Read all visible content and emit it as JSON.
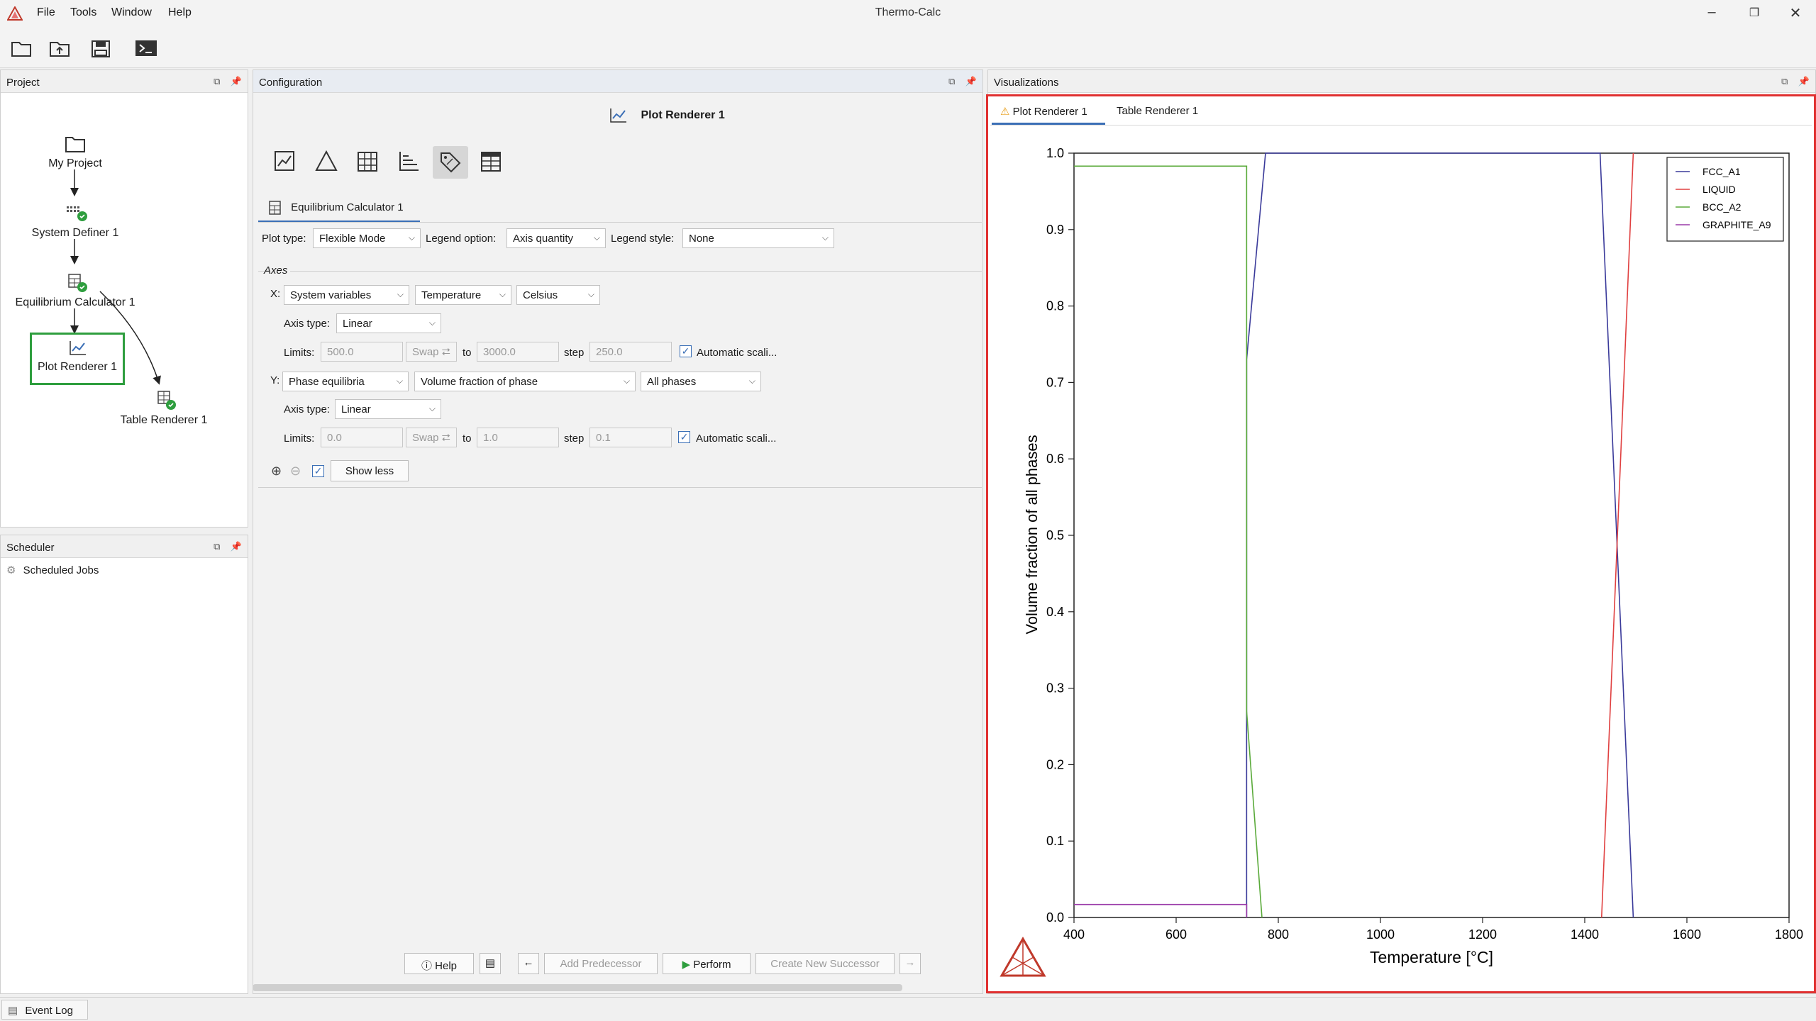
{
  "app": {
    "title": "Thermo-Calc",
    "menu": [
      "File",
      "Tools",
      "Window",
      "Help"
    ],
    "window_controls": {
      "minimize": "–",
      "restore": "❐",
      "close": "✕"
    }
  },
  "project_panel": {
    "title": "Project",
    "nodes": [
      {
        "label": "My Project"
      },
      {
        "label": "System Definer 1"
      },
      {
        "label": "Equilibrium Calculator 1"
      },
      {
        "label": "Plot Renderer 1"
      },
      {
        "label": "Table Renderer 1"
      }
    ]
  },
  "scheduler_panel": {
    "title": "Scheduler",
    "item": "Scheduled Jobs"
  },
  "configuration": {
    "panel_title": "Configuration",
    "heading": "Plot Renderer 1",
    "tab": "Equilibrium Calculator 1",
    "plot_type_label": "Plot type:",
    "plot_type_value": "Flexible Mode",
    "legend_option_label": "Legend option:",
    "legend_option_value": "Axis quantity",
    "legend_style_label": "Legend style:",
    "legend_style_value": "None",
    "axes_title": "Axes",
    "x": {
      "label": "X:",
      "category": "System variables",
      "quantity": "Temperature",
      "unit": "Celsius",
      "axis_type_label": "Axis type:",
      "axis_type": "Linear",
      "limits_label": "Limits:",
      "min": "500.0",
      "swap": "Swap",
      "to": "to",
      "max": "3000.0",
      "step_label": "step",
      "step": "250.0",
      "auto_label": "Automatic scali...",
      "auto_checked": true
    },
    "y": {
      "label": "Y:",
      "category": "Phase equilibria",
      "quantity": "Volume fraction of phase",
      "unit": "All phases",
      "axis_type_label": "Axis type:",
      "axis_type": "Linear",
      "limits_label": "Limits:",
      "min": "0.0",
      "swap": "Swap",
      "to": "to",
      "max": "1.0",
      "step_label": "step",
      "step": "0.1",
      "auto_label": "Automatic scali...",
      "auto_checked": true
    },
    "show_less": "Show less",
    "footer": {
      "help": "Help",
      "add_predecessor": "Add Predecessor",
      "perform": "Perform",
      "create_successor": "Create New Successor"
    }
  },
  "visualizations": {
    "panel_title": "Visualizations",
    "tabs": [
      "Plot Renderer 1",
      "Table Renderer 1"
    ],
    "active_tab": 0
  },
  "status_bar": {
    "event_log": "Event Log"
  },
  "colors": {
    "FCC_A1": "#3a3a9a",
    "LIQUID": "#e04040",
    "BCC_A2": "#5aaa3a",
    "GRAPHITE_A9": "#9a3aa8",
    "selection_green": "#2e9e3e",
    "highlight_red": "#e03030"
  },
  "chart_data": {
    "type": "line",
    "title": "",
    "xlabel": "Temperature [°C]",
    "ylabel": "Volume fraction of all phases",
    "xlim": [
      400,
      1800
    ],
    "ylim": [
      0,
      1.0
    ],
    "xticks": [
      "400",
      "600",
      "800",
      "1000",
      "1200",
      "1400",
      "1600",
      "1800"
    ],
    "yticks": [
      "0.0",
      "0.1",
      "0.2",
      "0.3",
      "0.4",
      "0.5",
      "0.6",
      "0.7",
      "0.8",
      "0.9",
      "1.0"
    ],
    "legend_position": "top-right",
    "grid": false,
    "series": [
      {
        "name": "FCC_A1",
        "points": [
          [
            738,
            0.0
          ],
          [
            738,
            0.73
          ],
          [
            775,
            1.0
          ],
          [
            1430,
            1.0
          ],
          [
            1495,
            0.0
          ]
        ]
      },
      {
        "name": "LIQUID",
        "points": [
          [
            1433,
            0.0
          ],
          [
            1495,
            1.0
          ]
        ]
      },
      {
        "name": "BCC_A2",
        "points": [
          [
            400,
            0.983
          ],
          [
            738,
            0.983
          ],
          [
            738,
            0.27
          ],
          [
            768,
            0.0
          ]
        ]
      },
      {
        "name": "GRAPHITE_A9",
        "points": [
          [
            400,
            0.017
          ],
          [
            738,
            0.017
          ],
          [
            738,
            0.0
          ]
        ]
      }
    ]
  }
}
